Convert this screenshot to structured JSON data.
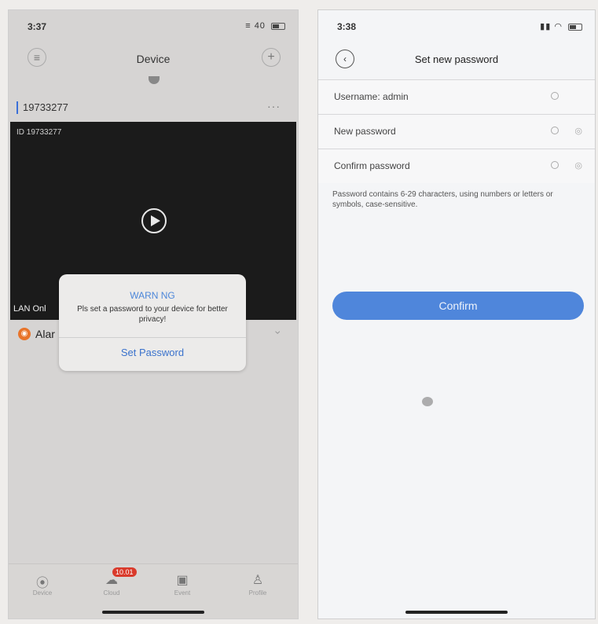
{
  "phone_a": {
    "status_time": "3:37",
    "status_right": "40",
    "title": "Device",
    "device_name": "19733277",
    "device_more": "···",
    "video_id": "ID 19733277",
    "lan_label": "LAN Onl",
    "alarm_label": "Alar",
    "dialog": {
      "title": "WARN NG",
      "message": "Pls set a password to your device for better privacy!",
      "button": "Set Password"
    },
    "tabs": [
      {
        "icon": "camera-icon",
        "label": "Device"
      },
      {
        "icon": "cloud-icon",
        "label": "Cloud",
        "badge": "10.01"
      },
      {
        "icon": "video-icon",
        "label": "Event"
      },
      {
        "icon": "profile-icon",
        "label": "Profile"
      }
    ]
  },
  "phone_b": {
    "status_time": "3:38",
    "title": "Set new password",
    "fields": [
      {
        "label": "Username: admin"
      },
      {
        "label": "New password"
      },
      {
        "label": "Confirm password"
      }
    ],
    "hint": "Password contains 6-29 characters, using numbers or letters or symbols, case-sensitive.",
    "confirm_button": "Confirm"
  },
  "colors": {
    "accent": "#4f86db",
    "badge": "#d93a2b",
    "alarm": "#e8742a"
  }
}
